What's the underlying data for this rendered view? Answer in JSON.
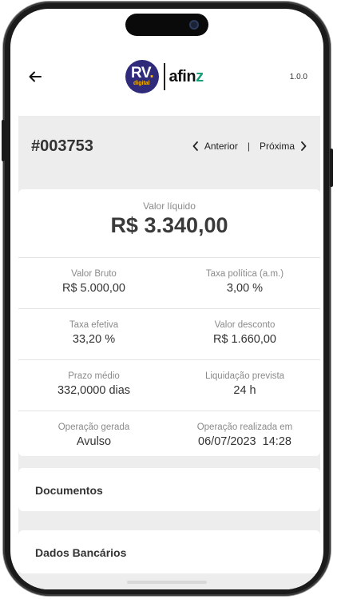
{
  "header": {
    "logo": {
      "rv": "RV",
      "rv_dot": ".",
      "digital": "digital",
      "afinz": "afin",
      "afinz_z": "z"
    },
    "version": "1.0.0"
  },
  "operation": {
    "number": "#003753",
    "prev_label": "Anterior",
    "separator": "|",
    "next_label": "Próxima"
  },
  "summary": {
    "net_label": "Valor líquido",
    "net_value": "R$ 3.340,00",
    "rows": [
      [
        {
          "label": "Valor Bruto",
          "value": "R$ 5.000,00"
        },
        {
          "label": "Taxa política (a.m.)",
          "value": "3,00 %"
        }
      ],
      [
        {
          "label": "Taxa efetiva",
          "value": "33,20 %"
        },
        {
          "label": "Valor desconto",
          "value": "R$ 1.660,00"
        }
      ],
      [
        {
          "label": "Prazo médio",
          "value": "332,0000 dias"
        },
        {
          "label": "Liquidação prevista",
          "value": "24 h"
        }
      ],
      [
        {
          "label": "Operação gerada",
          "value": "Avulso"
        },
        {
          "label": "Operação realizada em",
          "value": "06/07/2023  14:28"
        }
      ]
    ]
  },
  "sections": {
    "documents": "Documentos",
    "bank": "Dados Bancários"
  },
  "colors": {
    "brand_purple": "#2f2a7a",
    "brand_yellow": "#f7b500",
    "afinz_green": "#1a9e7a",
    "panel_gray": "#ededed"
  }
}
